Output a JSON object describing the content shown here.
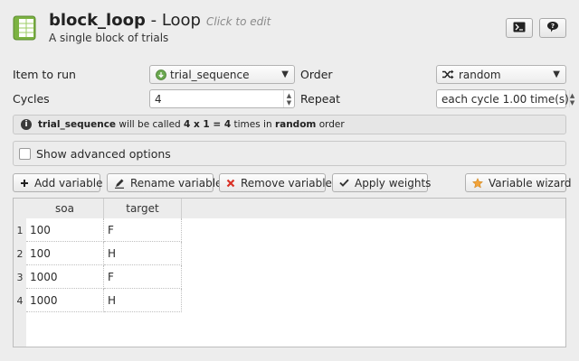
{
  "header": {
    "item_name": "block_loop",
    "separator": " - ",
    "item_type": "Loop",
    "edit_hint": "Click to edit",
    "description": "A single block of trials",
    "icons": {
      "item": "loop-table-icon",
      "script": "terminal-icon",
      "help": "help-speech-icon"
    }
  },
  "form": {
    "item_to_run_label": "Item to run",
    "item_to_run_value": "trial_sequence",
    "order_label": "Order",
    "order_value": "random",
    "cycles_label": "Cycles",
    "cycles_value": "4",
    "repeat_label": "Repeat",
    "repeat_value": "each cycle 1.00 time(s)"
  },
  "summary": {
    "item": "trial_sequence",
    "text1": " will be called ",
    "formula": "4 x 1 = 4",
    "text2": " times in ",
    "order": "random",
    "text3": " order"
  },
  "advanced": {
    "label": "Show advanced options",
    "checked": false
  },
  "toolbar": {
    "add_variable": "Add variable",
    "rename_variable": "Rename variable",
    "remove_variable": "Remove variable",
    "apply_weights": "Apply weights",
    "variable_wizard": "Variable wizard"
  },
  "table": {
    "columns": [
      "soa",
      "target"
    ],
    "rows": [
      {
        "index": "1",
        "soa": "100",
        "target": "F"
      },
      {
        "index": "2",
        "soa": "100",
        "target": "H"
      },
      {
        "index": "3",
        "soa": "1000",
        "target": "F"
      },
      {
        "index": "4",
        "soa": "1000",
        "target": "H"
      }
    ]
  },
  "colors": {
    "item_icon_green": "#6aa84f",
    "remove_red": "#d93025",
    "wizard_orange": "#f2a33a"
  }
}
